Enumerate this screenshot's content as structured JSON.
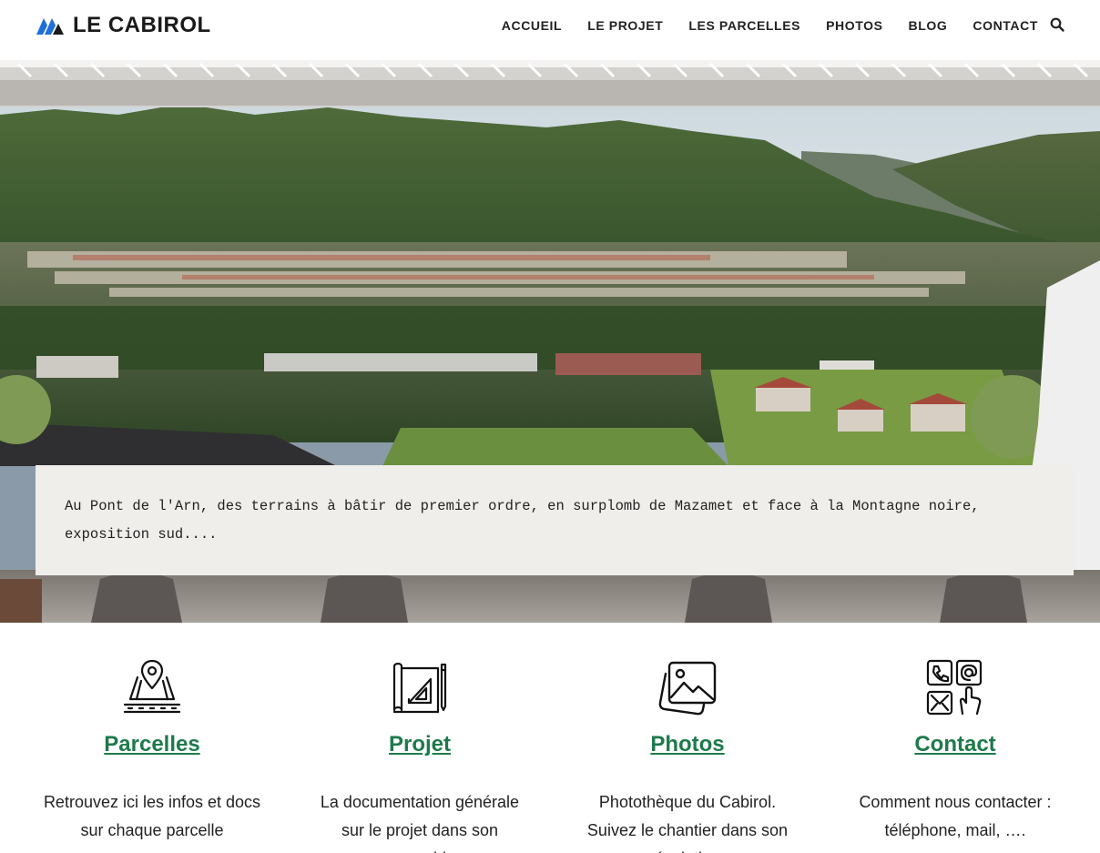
{
  "brand": {
    "name": "LE CABIROL",
    "logo_icon": "mountain-logo-icon",
    "logo_color": "#1e6fd9"
  },
  "nav": {
    "items": [
      "ACCUEIL",
      "LE PROJET",
      "LES PARCELLES",
      "PHOTOS",
      "BLOG",
      "CONTACT"
    ],
    "search_icon": "search-icon"
  },
  "hero": {
    "caption": "Au Pont de l'Arn, des terrains à bâtir de premier ordre, en surplomb de Mazamet et face à la Montagne noire, exposition sud...."
  },
  "features": [
    {
      "icon": "map-pin-plot-icon",
      "title": "Parcelles",
      "description": "Retrouvez ici les infos et docs sur chaque parcelle"
    },
    {
      "icon": "blueprint-icon",
      "title": "Projet",
      "description": "La documentation générale sur le projet dans son ensemble"
    },
    {
      "icon": "photo-gallery-icon",
      "title": "Photos",
      "description": "Photothèque du Cabirol. Suivez le chantier dans son évolution"
    },
    {
      "icon": "contact-channels-icon",
      "title": "Contact",
      "description": "Comment nous contacter : téléphone, mail, …."
    }
  ],
  "colors": {
    "accent_green": "#1e7a4b",
    "caption_bg": "#efeeea"
  }
}
